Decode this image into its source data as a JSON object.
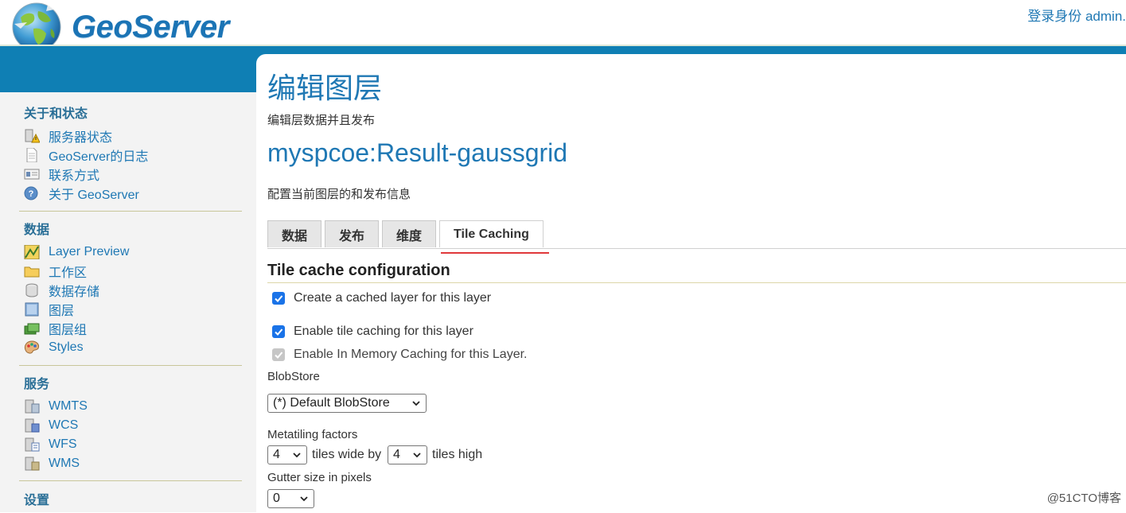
{
  "header": {
    "logo_text": "GeoServer",
    "login_text": "登录身份 admin."
  },
  "sidebar": {
    "sections": [
      {
        "title": "关于和状态",
        "items": [
          {
            "label": "服务器状态",
            "icon": "server-status-icon"
          },
          {
            "label": "GeoServer的日志",
            "icon": "log-document-icon"
          },
          {
            "label": "联系方式",
            "icon": "contact-card-icon"
          },
          {
            "label": "关于 GeoServer",
            "icon": "about-info-icon"
          }
        ]
      },
      {
        "title": "数据",
        "items": [
          {
            "label": "Layer Preview",
            "icon": "layer-preview-icon"
          },
          {
            "label": "工作区",
            "icon": "folder-icon"
          },
          {
            "label": "数据存储",
            "icon": "database-icon"
          },
          {
            "label": "图层",
            "icon": "layer-icon"
          },
          {
            "label": "图层组",
            "icon": "layer-group-icon"
          },
          {
            "label": "Styles",
            "icon": "palette-icon"
          }
        ]
      },
      {
        "title": "服务",
        "items": [
          {
            "label": "WMTS",
            "icon": "wmts-service-icon"
          },
          {
            "label": "WCS",
            "icon": "wcs-service-icon"
          },
          {
            "label": "WFS",
            "icon": "wfs-service-icon"
          },
          {
            "label": "WMS",
            "icon": "wms-service-icon"
          }
        ]
      },
      {
        "title": "设置",
        "items": []
      }
    ]
  },
  "main": {
    "title": "编辑图层",
    "subtitle": "编辑层数据并且发布",
    "layer_name": "myspcoe:Result-gaussgrid",
    "layer_subtitle": "配置当前图层的和发布信息",
    "tabs": [
      {
        "label": "数据",
        "active": false
      },
      {
        "label": "发布",
        "active": false
      },
      {
        "label": "维度",
        "active": false
      },
      {
        "label": "Tile Caching",
        "active": true
      }
    ],
    "section_title": "Tile cache configuration",
    "checkboxes": {
      "create_cached_layer": {
        "label": "Create a cached layer for this layer",
        "checked": true,
        "disabled": false
      },
      "enable_tile_caching": {
        "label": "Enable tile caching for this layer",
        "checked": true,
        "disabled": false
      },
      "in_memory_caching": {
        "label": "Enable In Memory Caching for this Layer.",
        "checked": true,
        "disabled": true
      }
    },
    "blobstore": {
      "label": "BlobStore",
      "selected": "(*) Default BlobStore"
    },
    "metatiling": {
      "label": "Metatiling factors",
      "wide_value": "4",
      "wide_text": "tiles wide by",
      "high_value": "4",
      "high_text": "tiles high"
    },
    "gutter": {
      "label": "Gutter size in pixels",
      "value": "0"
    }
  },
  "watermark": "@51CTO博客",
  "colors": {
    "accent_blue": "#1f78b4",
    "header_band": "#0f7fb4",
    "checkbox_blue": "#1a73e8",
    "active_tab_underline": "#e0393b"
  }
}
